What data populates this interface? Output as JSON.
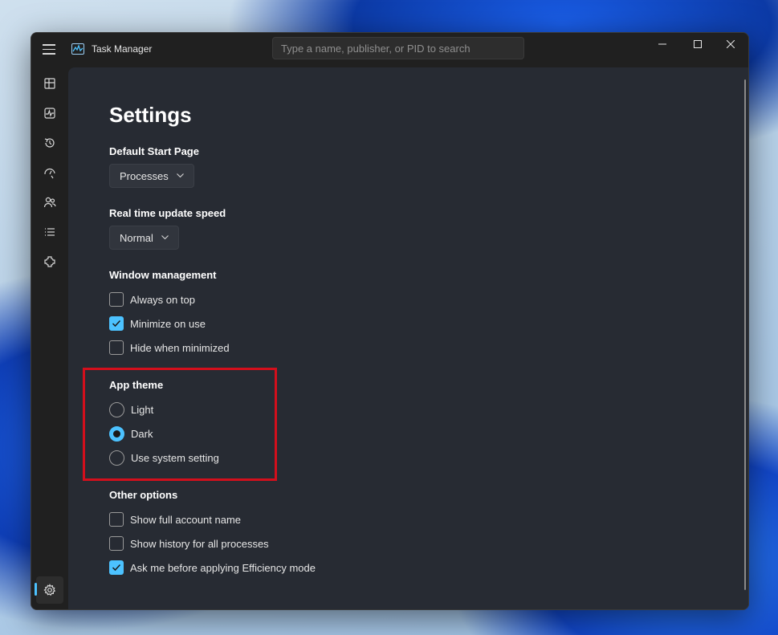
{
  "window": {
    "title": "Task Manager",
    "search_placeholder": "Type a name, publisher, or PID to search"
  },
  "sidebar": {
    "items": [
      {
        "icon": "processes-icon"
      },
      {
        "icon": "performance-icon"
      },
      {
        "icon": "app-history-icon"
      },
      {
        "icon": "startup-apps-icon"
      },
      {
        "icon": "users-icon"
      },
      {
        "icon": "details-icon"
      },
      {
        "icon": "services-icon"
      }
    ],
    "settings_icon": "settings-icon"
  },
  "page": {
    "title": "Settings",
    "default_start_page": {
      "label": "Default Start Page",
      "value": "Processes"
    },
    "update_speed": {
      "label": "Real time update speed",
      "value": "Normal"
    },
    "window_management": {
      "label": "Window management",
      "options": [
        {
          "label": "Always on top",
          "checked": false
        },
        {
          "label": "Minimize on use",
          "checked": true
        },
        {
          "label": "Hide when minimized",
          "checked": false
        }
      ]
    },
    "app_theme": {
      "label": "App theme",
      "options": [
        {
          "label": "Light",
          "selected": false
        },
        {
          "label": "Dark",
          "selected": true
        },
        {
          "label": "Use system setting",
          "selected": false
        }
      ]
    },
    "other_options": {
      "label": "Other options",
      "options": [
        {
          "label": "Show full account name",
          "checked": false
        },
        {
          "label": "Show history for all processes",
          "checked": false
        },
        {
          "label": "Ask me before applying Efficiency mode",
          "checked": true
        }
      ]
    }
  },
  "colors": {
    "accent": "#4cc2ff",
    "highlight": "#d30f1c",
    "content_bg": "#272b33",
    "chrome_bg": "#202020"
  }
}
